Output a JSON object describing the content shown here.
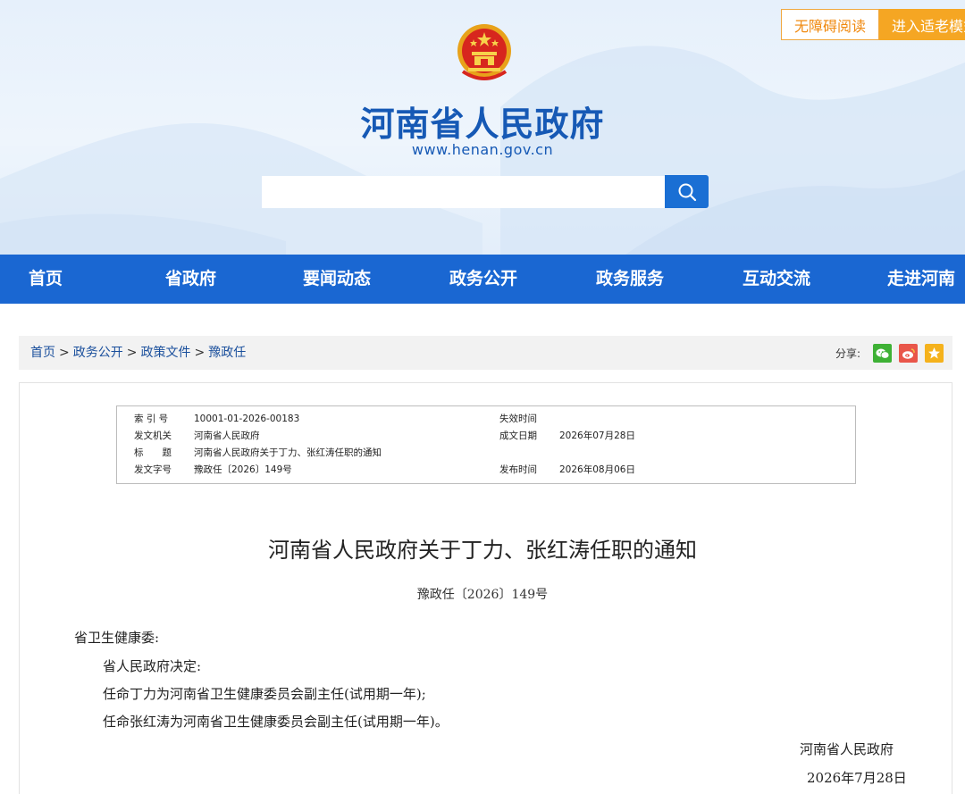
{
  "header": {
    "site_title": "河南省人民政府",
    "site_url": "www.henan.gov.cn",
    "search_placeholder": "",
    "accessibility_label": "无障碍阅读",
    "elder_mode_label": "进入适老模式"
  },
  "nav": {
    "items": [
      "首页",
      "省政府",
      "要闻动态",
      "政务公开",
      "政务服务",
      "互动交流",
      "走进河南"
    ]
  },
  "breadcrumb": {
    "items": [
      "首页",
      "政务公开",
      "政策文件",
      "豫政任"
    ],
    "separator": ">"
  },
  "share": {
    "label": "分享:",
    "icons": [
      "wechat-icon",
      "weibo-icon",
      "qzone-icon"
    ]
  },
  "meta": {
    "index_label": "索 引 号",
    "index_value": "10001-01-2026-00183",
    "expire_label": "失效时间",
    "expire_value": "",
    "issuer_label": "发文机关",
    "issuer_value": "河南省人民政府",
    "written_label": "成文日期",
    "written_value": "2026年07月28日",
    "title_label": "标　　题",
    "title_value": "河南省人民政府关于丁力、张红涛任职的通知",
    "docno_label": "发文字号",
    "docno_value": "豫政任〔2026〕149号",
    "publish_label": "发布时间",
    "publish_value": "2026年08月06日"
  },
  "article": {
    "title": "河南省人民政府关于丁力、张红涛任职的通知",
    "doc_number": "豫政任〔2026〕149号",
    "recipient": "省卫生健康委:",
    "paragraphs": [
      "省人民政府决定:",
      "任命丁力为河南省卫生健康委员会副主任(试用期一年);",
      "任命张红涛为河南省卫生健康委员会副主任(试用期一年)。"
    ],
    "signature": "河南省人民政府",
    "date": "2026年7月28日"
  },
  "colors": {
    "brand_blue": "#1a67d2",
    "title_blue": "#1659b5",
    "accent_orange": "#f5a623"
  }
}
